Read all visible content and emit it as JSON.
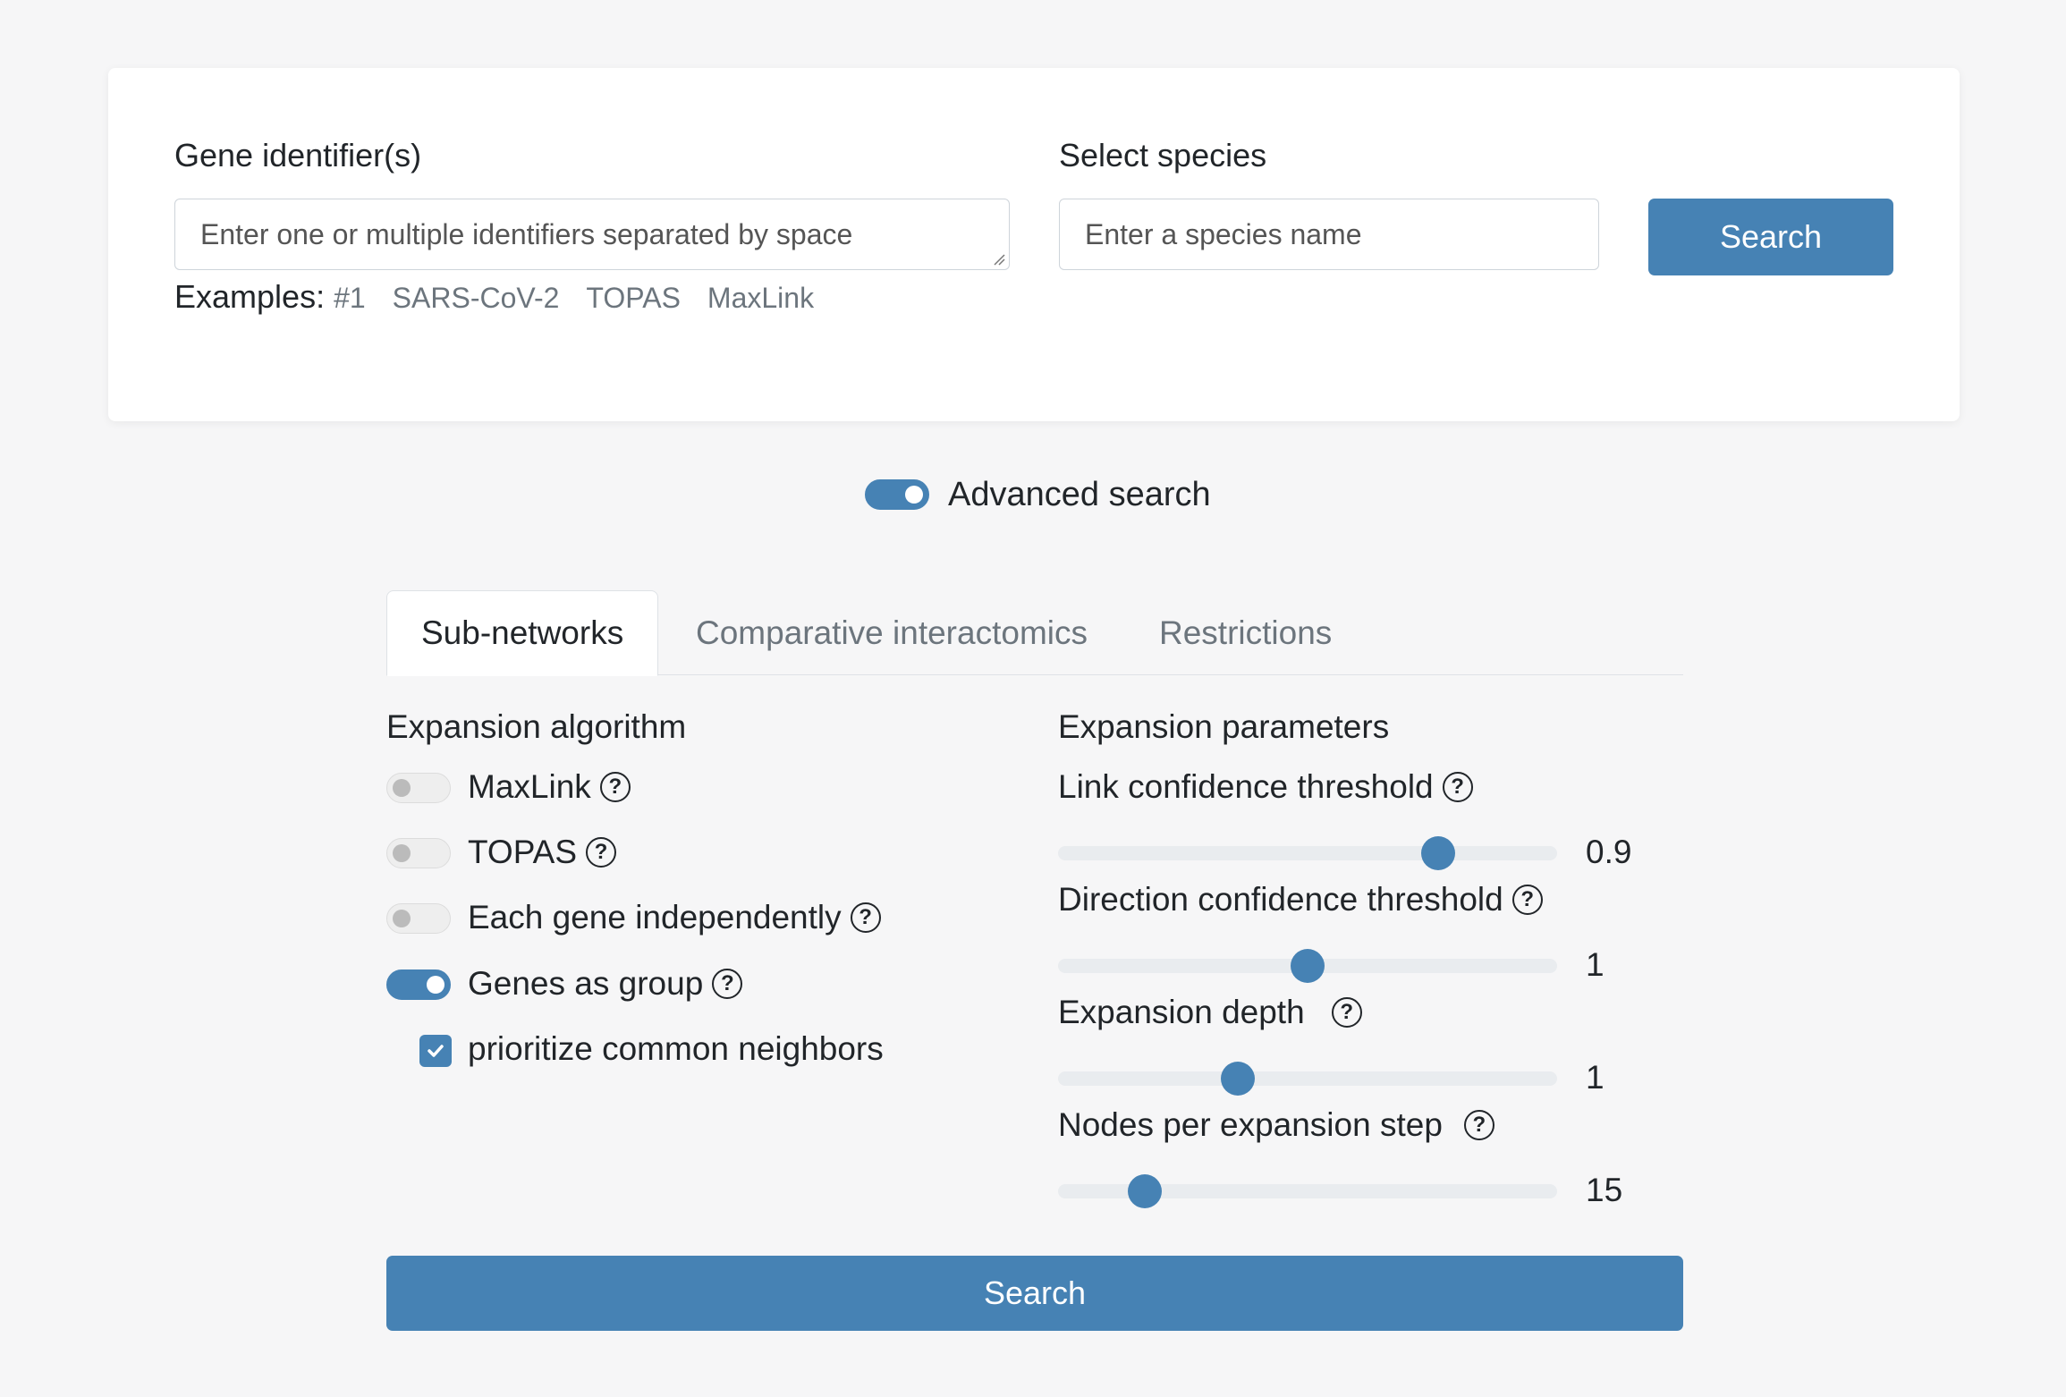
{
  "search": {
    "gene_label": "Gene identifier(s)",
    "gene_placeholder": "Enter one or multiple identifiers separated by space",
    "species_label": "Select species",
    "species_placeholder": "Enter a species name",
    "search_button": "Search",
    "examples_label": "Examples:",
    "examples": [
      "#1",
      "SARS-CoV-2",
      "TOPAS",
      "MaxLink"
    ]
  },
  "advanced": {
    "label": "Advanced search",
    "enabled": true
  },
  "tabs": [
    {
      "label": "Sub-networks",
      "active": true
    },
    {
      "label": "Comparative interactomics",
      "active": false
    },
    {
      "label": "Restrictions",
      "active": false
    }
  ],
  "algorithm": {
    "title": "Expansion algorithm",
    "options": [
      {
        "label": "MaxLink",
        "on": false
      },
      {
        "label": "TOPAS",
        "on": false
      },
      {
        "label": "Each gene independently",
        "on": false
      },
      {
        "label": "Genes as group",
        "on": true
      }
    ],
    "checkbox_label": "prioritize common neighbors",
    "checkbox_checked": true
  },
  "parameters": {
    "title": "Expansion parameters",
    "sliders": [
      {
        "label": "Link confidence threshold",
        "value": "0.9",
        "fraction": 0.78
      },
      {
        "label": "Direction confidence threshold",
        "value": "1",
        "fraction": 0.5
      },
      {
        "label": "Expansion depth",
        "value": "1",
        "fraction": 0.35
      },
      {
        "label": "Nodes per expansion step",
        "value": "15",
        "fraction": 0.15
      }
    ]
  },
  "bottom_search_button": "Search",
  "colors": {
    "accent": "#4682b4",
    "background": "#f6f6f7"
  },
  "icons": {
    "help": "question-circle-icon",
    "check": "check-icon"
  }
}
